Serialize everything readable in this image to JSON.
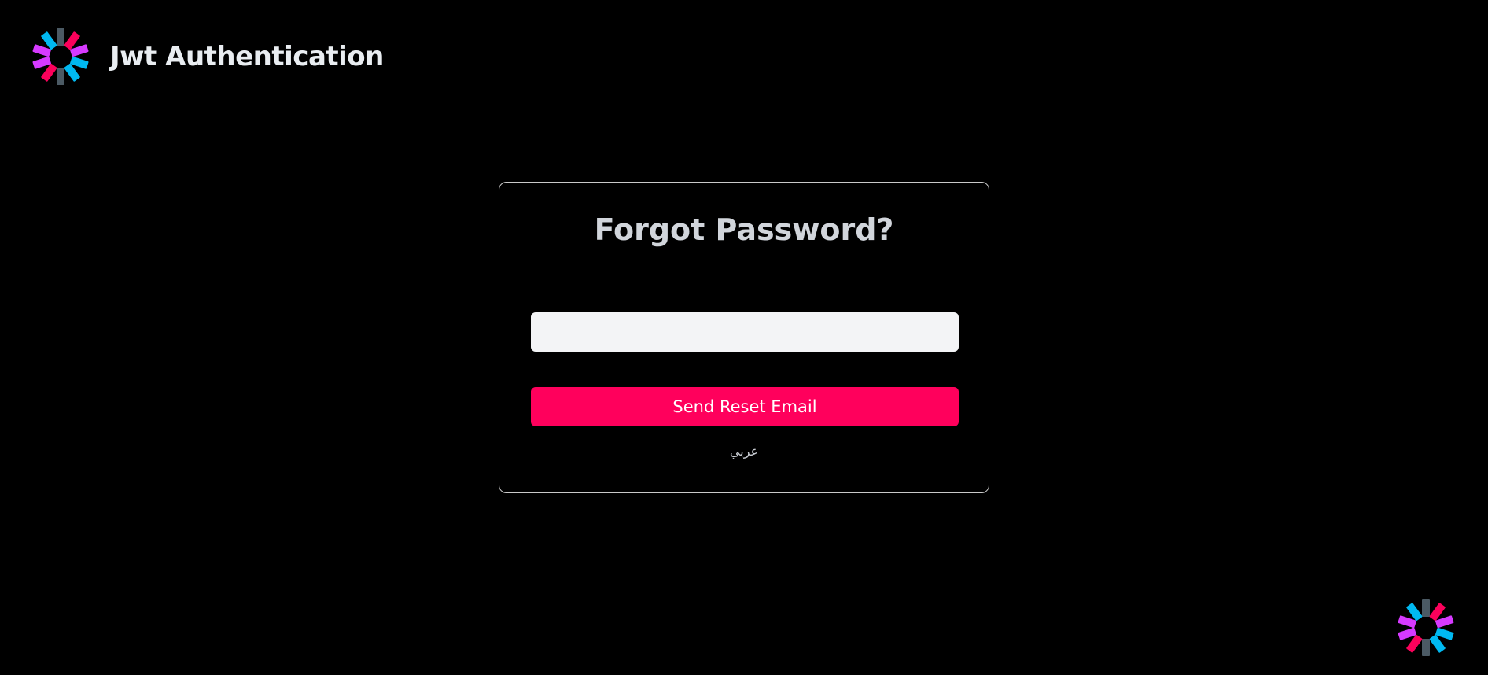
{
  "header": {
    "logo_icon": "jwt-logo-icon",
    "title": "Jwt Authentication"
  },
  "form": {
    "title": "Forgot Password?",
    "email_value": "",
    "email_placeholder": "",
    "submit_label": "Send Reset Email",
    "language_link": "عربي"
  },
  "footer": {
    "corner_icon": "jwt-logo-icon"
  },
  "colors": {
    "background": "#000000",
    "accent": "#ff005c",
    "logo_cyan": "#00b9f1",
    "logo_magenta": "#d63aff",
    "logo_pink": "#fb015b",
    "logo_gray": "#4b5a64"
  }
}
